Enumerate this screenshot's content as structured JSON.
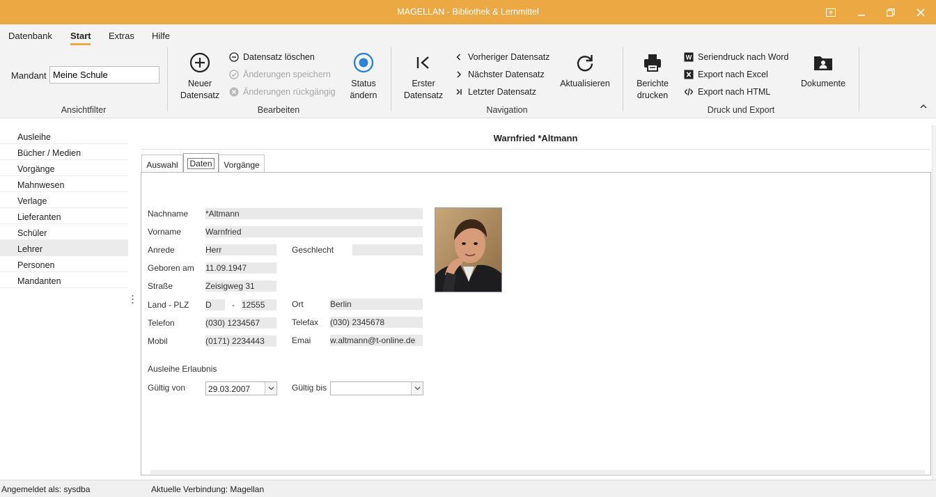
{
  "window": {
    "title": "MAGELLAN - Bibliothek & Lernmittel"
  },
  "menu": {
    "items": [
      "Datenbank",
      "Start",
      "Extras",
      "Hilfe"
    ],
    "active": "Start"
  },
  "ribbon": {
    "ansichtfilter": {
      "mandant_label": "Mandant",
      "mandant_value": "Meine Schule",
      "group_label": "Ansichtfilter"
    },
    "bearbeiten": {
      "neuer_line1": "Neuer",
      "neuer_line2": "Datensatz",
      "loeschen": "Datensatz löschen",
      "speichern": "Änderungen speichern",
      "rueckgaengig": "Änderungen rückgängig",
      "status_line1": "Status",
      "status_line2": "ändern",
      "group_label": "Bearbeiten"
    },
    "navigation": {
      "erster_line1": "Erster",
      "erster_line2": "Datensatz",
      "vorheriger": "Vorheriger Datensatz",
      "naechster": "Nächster Datensatz",
      "letzter": "Letzter Datensatz",
      "aktualisieren": "Aktualisieren",
      "group_label": "Navigation"
    },
    "druck": {
      "berichte_line1": "Berichte",
      "berichte_line2": "drucken",
      "word": "Seriendruck nach Word",
      "excel": "Export nach Excel",
      "html": "Export nach HTML",
      "dokumente": "Dokumente",
      "group_label": "Druck und Export"
    }
  },
  "sidebar": {
    "items": [
      "Ausleihe",
      "Bücher / Medien",
      "Vorgänge",
      "Mahnwesen",
      "Verlage",
      "Lieferanten",
      "Schüler",
      "Lehrer",
      "Personen",
      "Mandanten"
    ],
    "selected": "Lehrer"
  },
  "main": {
    "title": "Warnfried *Altmann",
    "tabs": [
      "Auswahl",
      "Daten",
      "Vorgänge"
    ],
    "active_tab": "Daten"
  },
  "form": {
    "nachname_label": "Nachname",
    "nachname": "*Altmann",
    "vorname_label": "Vorname",
    "vorname": "Warnfried",
    "anrede_label": "Anrede",
    "anrede": "Herr",
    "geschlecht_label": "Geschlecht",
    "geschlecht": "",
    "geboren_label": "Geboren am",
    "geboren": "11.09.1947",
    "strasse_label": "Straße",
    "strasse": "Zeisigweg 31",
    "land_plz_label": "Land - PLZ",
    "land": "D",
    "dash": "-",
    "plz": "12555",
    "ort_label": "Ort",
    "ort": "Berlin",
    "telefon_label": "Telefon",
    "telefon": "(030) 1234567",
    "telefax_label": "Telefax",
    "telefax": "(030) 2345678",
    "mobil_label": "Mobil",
    "mobil": "(0171) 2234443",
    "email_label": "Emai",
    "email": "w.altmann@t-online.de",
    "ausleihe_label": "Ausleihe Erlaubnis",
    "gueltig_von_label": "Gültig von",
    "gueltig_von": "29.03.2007",
    "gueltig_bis_label": "Gültig bis",
    "gueltig_bis": ""
  },
  "status": {
    "user": "Angemeldet als: sysdba",
    "connection": "Aktuelle Verbindung: Magellan"
  },
  "colors": {
    "accent": "#eca843",
    "status_blue": "#2f83d3"
  }
}
